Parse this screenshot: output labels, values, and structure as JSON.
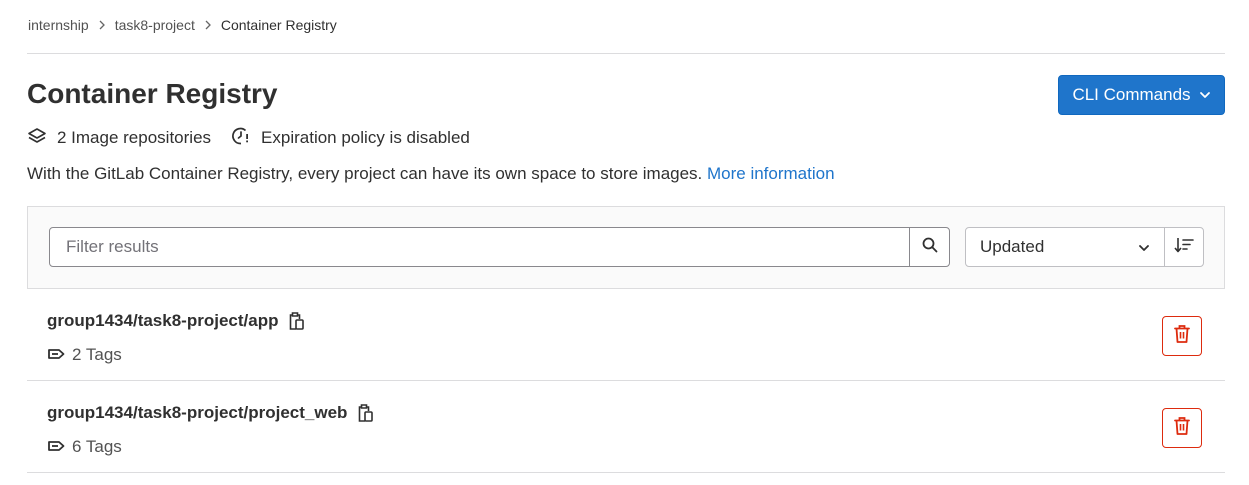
{
  "breadcrumb": {
    "items": [
      "internship",
      "task8-project"
    ],
    "current": "Container Registry"
  },
  "header": {
    "title": "Container Registry",
    "cli_button_label": "CLI Commands"
  },
  "meta": {
    "repositories": "2 Image repositories",
    "expiration": "Expiration policy is disabled"
  },
  "info": {
    "text": "With the GitLab Container Registry, every project can have its own space to store images. ",
    "link": "More information"
  },
  "filter": {
    "placeholder": "Filter results",
    "sort_value": "Updated"
  },
  "repos": [
    {
      "name": "group1434/task8-project/app",
      "tags": "2 Tags"
    },
    {
      "name": "group1434/task8-project/project_web",
      "tags": "6 Tags"
    }
  ],
  "colors": {
    "primary": "#1f75cb",
    "danger": "#dd2b0e",
    "text": "#303030",
    "border": "#dcdcde"
  }
}
